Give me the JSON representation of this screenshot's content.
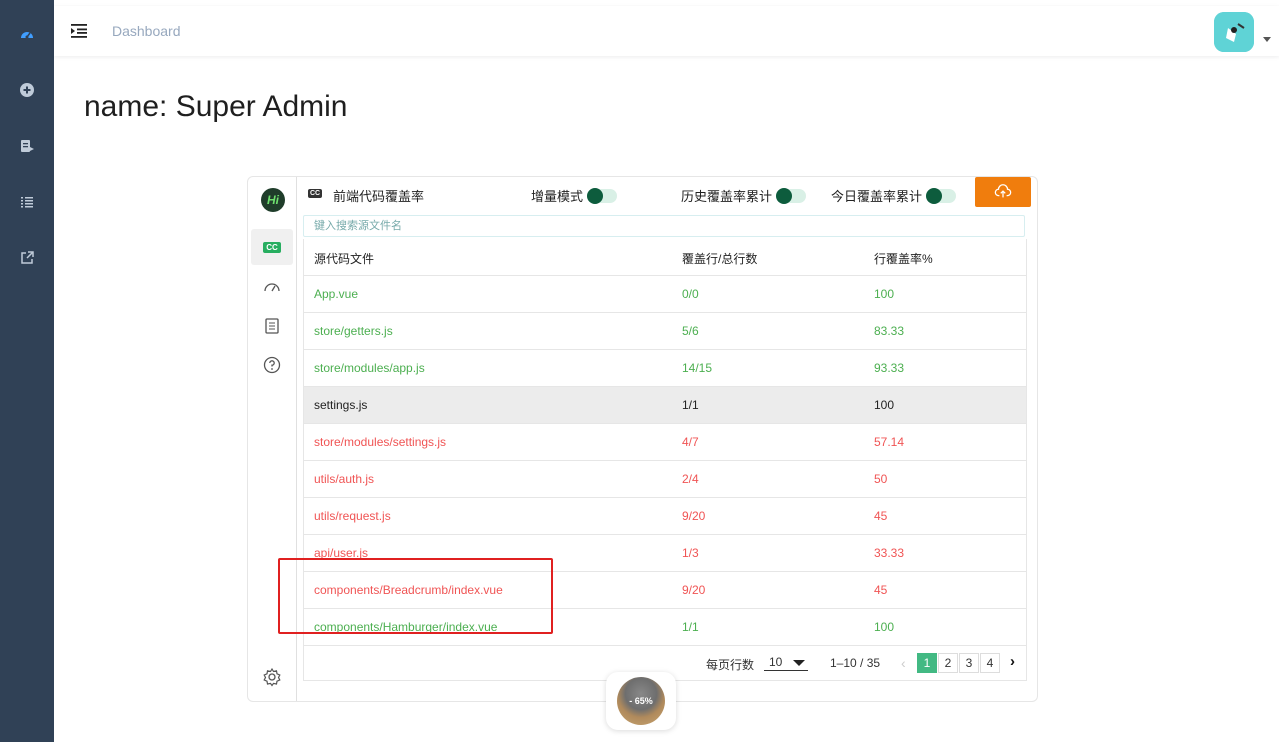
{
  "navbar": {
    "breadcrumb": "Dashboard"
  },
  "page": {
    "title": "name: Super Admin"
  },
  "panel": {
    "logo": "Hi",
    "cc_badge": "CC",
    "header_title": "前端代码覆盖率",
    "toggles": [
      {
        "label": "增量模式",
        "on": true
      },
      {
        "label": "历史覆盖率累计",
        "on": true
      },
      {
        "label": "今日覆盖率累计",
        "on": true
      }
    ],
    "search_placeholder": "键入搜索源文件名",
    "columns": [
      "源代码文件",
      "覆盖行/总行数",
      "行覆盖率%"
    ],
    "rows": [
      {
        "file": "App.vue",
        "lines": "0/0",
        "rate": "100",
        "status": "green"
      },
      {
        "file": "store/getters.js",
        "lines": "5/6",
        "rate": "83.33",
        "status": "green"
      },
      {
        "file": "store/modules/app.js",
        "lines": "14/15",
        "rate": "93.33",
        "status": "green"
      },
      {
        "file": "settings.js",
        "lines": "1/1",
        "rate": "100",
        "status": "gray"
      },
      {
        "file": "store/modules/settings.js",
        "lines": "4/7",
        "rate": "57.14",
        "status": "red"
      },
      {
        "file": "utils/auth.js",
        "lines": "2/4",
        "rate": "50",
        "status": "red"
      },
      {
        "file": "utils/request.js",
        "lines": "9/20",
        "rate": "45",
        "status": "red"
      },
      {
        "file": "api/user.js",
        "lines": "1/3",
        "rate": "33.33",
        "status": "red"
      },
      {
        "file": "components/Breadcrumb/index.vue",
        "lines": "9/20",
        "rate": "45",
        "status": "red"
      },
      {
        "file": "components/Hamburger/index.vue",
        "lines": "1/1",
        "rate": "100",
        "status": "green"
      }
    ],
    "pagination": {
      "rows_per_page_label": "每页行数",
      "rows_per_page": "10",
      "range": "1–10 / 35",
      "pages": [
        "1",
        "2",
        "3",
        "4"
      ],
      "current_page": "1",
      "prev": "‹",
      "next": "›"
    }
  },
  "zoom_widget": {
    "label": "- 65%"
  },
  "colors": {
    "sidebar": "#304156",
    "pass": "#4caf50",
    "fail": "#f05454",
    "accent": "#42b983",
    "upload": "#f07d0d"
  }
}
